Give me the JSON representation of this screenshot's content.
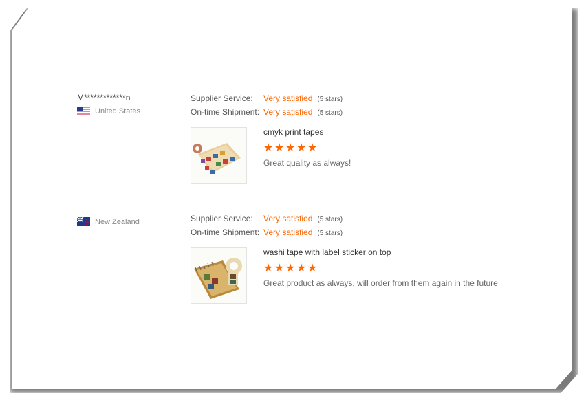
{
  "colors": {
    "accent": "#ff6600",
    "divider": "#e0e0e0"
  },
  "reviews": [
    {
      "buyer": "M*************n",
      "country": "United States",
      "flag": "us-flag-icon",
      "supplier_service": {
        "label": "Supplier Service:",
        "value": "Very satisfied",
        "stars": "(5 stars)"
      },
      "shipment": {
        "label": "On-time Shipment:",
        "value": "Very satisfied",
        "stars": "(5 stars)"
      },
      "product_title": "cmyk print tapes",
      "rating": 5,
      "comment": "Great quality as always!"
    },
    {
      "buyer": "",
      "country": "New Zealand",
      "flag": "nz-flag-icon",
      "supplier_service": {
        "label": "Supplier Service:",
        "value": "Very satisfied",
        "stars": "(5 stars)"
      },
      "shipment": {
        "label": "On-time Shipment:",
        "value": "Very satisfied",
        "stars": "(5 stars)"
      },
      "product_title": "washi tape with label sticker on top",
      "rating": 5,
      "comment": "Great product as always, will order from them again in the future"
    }
  ]
}
